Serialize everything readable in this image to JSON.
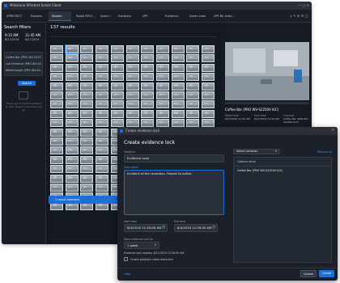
{
  "app": {
    "title": "Milestone XProtect Smart Client",
    "tabs": [
      "XPROTECT",
      "Exports",
      "Search",
      "Rapid REVi...",
      "Alarm...",
      "Evidence",
      "LPR",
      "Evidence",
      "Alarm Lists",
      "LPR Bk Actio..."
    ],
    "active_tab_index": 2
  },
  "search_filters": {
    "title": "Search filters",
    "start_time": "9:15 AM",
    "end_time": "11:45 AM",
    "date_from": "6/27/2019",
    "date_to": "6/27/2019",
    "cameras": [
      "Coffee Bar (PRO WV-S2250V K/C)",
      "Lab Entrance (PRO WV-S2...)",
      "Walkthrough (PRO WV-S4...)"
    ],
    "search_button": "Search",
    "empty_hint": "There are no matching filters to add. Search criteria are set up."
  },
  "results": {
    "count_label": "137 results",
    "select_bar_label": "1 result selected"
  },
  "preview": {
    "camera_name": "Coffee Bar (PRO WV-S2250V K/C)",
    "detail_labels": [
      "Start time",
      "End time",
      "Camera"
    ],
    "detail_values": [
      "6/27/2019 11:29 AM",
      "6/27/2019 11:30 AM",
      "Coffee Bar (PRO WV-S2250V K/C)"
    ]
  },
  "dialog": {
    "window_title": "Create evidence lock",
    "heading": "Create evidence lock",
    "headline_label": "Headline",
    "headline_value": "Evidence Lock",
    "description_label": "Description",
    "description_value": "Incident at the reception. Report to police.",
    "start_time_label": "Start time",
    "start_time_value": "6/4/2019 11:59:00 AM",
    "end_time_label": "End time",
    "end_time_value": "6/4/2019 11:59:00 AM",
    "keep_label": "Keep evidence lock for",
    "keep_value": "1 week",
    "expires_text": "Evidence lock expires: 6/11/2019 11:59:00 AM",
    "checkbox_label": "Create playback video restriction",
    "select_cameras_label": "Select cameras",
    "remove_all_label": "Remove all",
    "camera_list_header": "Camera name",
    "camera_list_items": [
      "Coffee Bar (PRO WV-S2250V K/C)"
    ],
    "help_label": "Help",
    "cancel_label": "Cancel",
    "create_label": "Create"
  },
  "colors": {
    "accent": "#1d6fd6",
    "panel": "#1c2129",
    "background": "#141820"
  }
}
